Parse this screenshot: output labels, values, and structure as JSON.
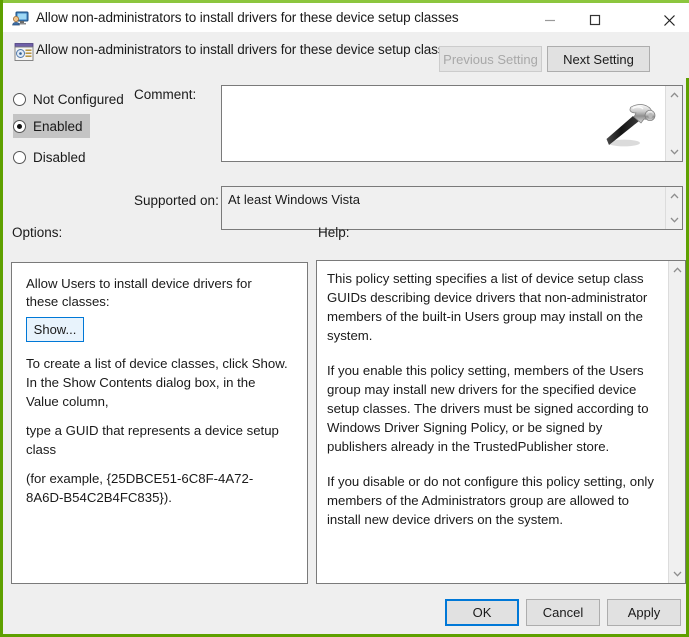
{
  "window": {
    "title": "Allow non-administrators to install drivers for these device setup classes",
    "accent_color": "#8cc63e",
    "border_color": "#5ea000",
    "controls": {
      "minimize": "minimize-icon",
      "maximize": "maximize-icon",
      "close": "close-icon"
    },
    "icon": "computer-user-icon"
  },
  "header": {
    "icon": "policy-setting-icon",
    "title": "Allow non-administrators to install drivers for these device setup classes",
    "previous_setting_label": "Previous Setting",
    "previous_setting_enabled": false,
    "next_setting_label": "Next Setting",
    "next_setting_enabled": true
  },
  "state": {
    "options": [
      {
        "id": "not-configured",
        "label": "Not Configured",
        "selected": false
      },
      {
        "id": "enabled",
        "label": "Enabled",
        "selected": true
      },
      {
        "id": "disabled",
        "label": "Disabled",
        "selected": false
      }
    ],
    "selected_state": "Enabled"
  },
  "comment": {
    "label": "Comment:",
    "value": "",
    "watermark_icon": "hammer-icon"
  },
  "supported_on": {
    "label": "Supported on:",
    "value": "At least Windows Vista",
    "readonly": true
  },
  "options_panel": {
    "label": "Options:",
    "setting_label": "Allow Users to install device drivers for these classes:",
    "show_button_label": "Show...",
    "paragraphs": [
      "To create a list of device classes, click Show. In the Show Contents dialog box, in the Value column,",
      "type a GUID that represents a device setup class",
      "(for example, {25DBCE51-6C8F-4A72-8A6D-B54C2B4FC835})."
    ]
  },
  "help_panel": {
    "label": "Help:",
    "paragraphs": [
      "This policy setting specifies a list of device setup class GUIDs describing device drivers that non-administrator members of the built-in Users group may install on the system.",
      "If you enable this policy setting, members of the Users group may install new drivers for the specified device setup classes. The drivers must be signed according to Windows Driver Signing Policy, or be signed by publishers already in the TrustedPublisher store.",
      "If you disable or do not configure this policy setting, only members of the Administrators group are allowed to install new device drivers on the system."
    ]
  },
  "footer": {
    "ok_label": "OK",
    "cancel_label": "Cancel",
    "apply_label": "Apply",
    "focused_button": "OK"
  }
}
